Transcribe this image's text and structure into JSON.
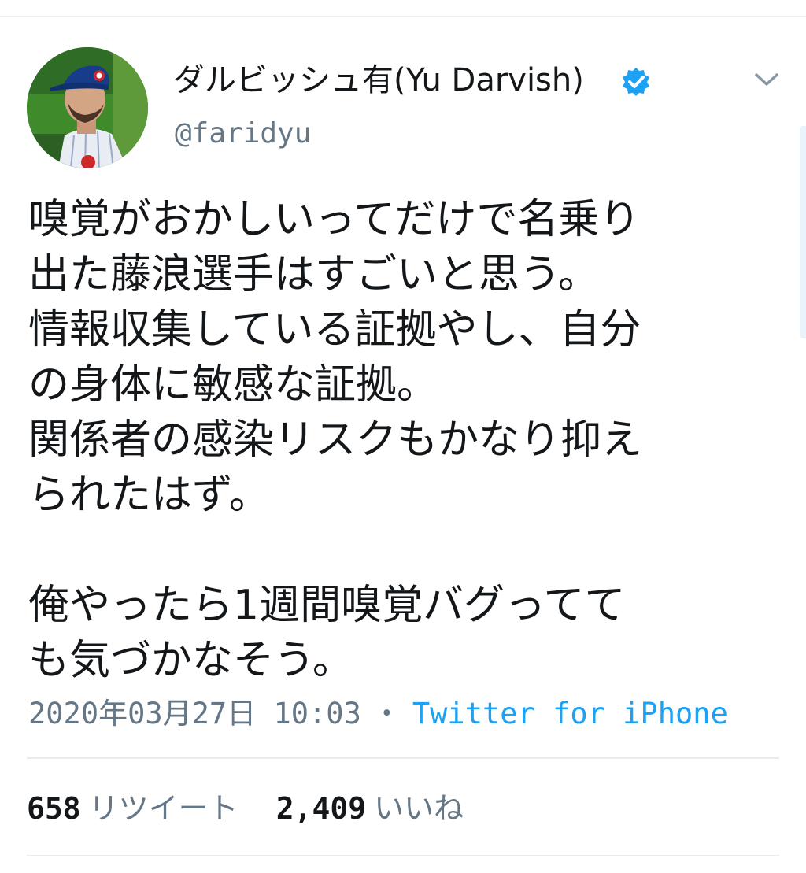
{
  "tweet": {
    "author": {
      "display_name": "ダルビッシュ有(Yu Darvish)",
      "handle": "@faridyu",
      "verified": true,
      "avatar_icon": "profile-photo"
    },
    "text": "嗅覚がおかしいってだけで名乗り\n出た藤浪選手はすごいと思う。\n情報収集している証拠やし、自分\nの身体に敏感な証拠。\n関係者の感染リスクもかなり抑え\nられたはず。\n\n俺やったら1週間嗅覚バグってて\nも気づかなそう。",
    "date": "2020年03月27日 10:03",
    "separator": "・",
    "source": "Twitter for iPhone",
    "stats": {
      "retweets_count": "658",
      "retweets_label": "リツイート",
      "likes_count": "2,409",
      "likes_label": "いいね"
    }
  },
  "icons": {
    "verified": "verified-badge-icon",
    "more": "chevron-down-icon"
  },
  "colors": {
    "text_primary": "#14171a",
    "text_secondary": "#657786",
    "link_blue": "#1da1f2",
    "divider": "#e6ecf0"
  }
}
